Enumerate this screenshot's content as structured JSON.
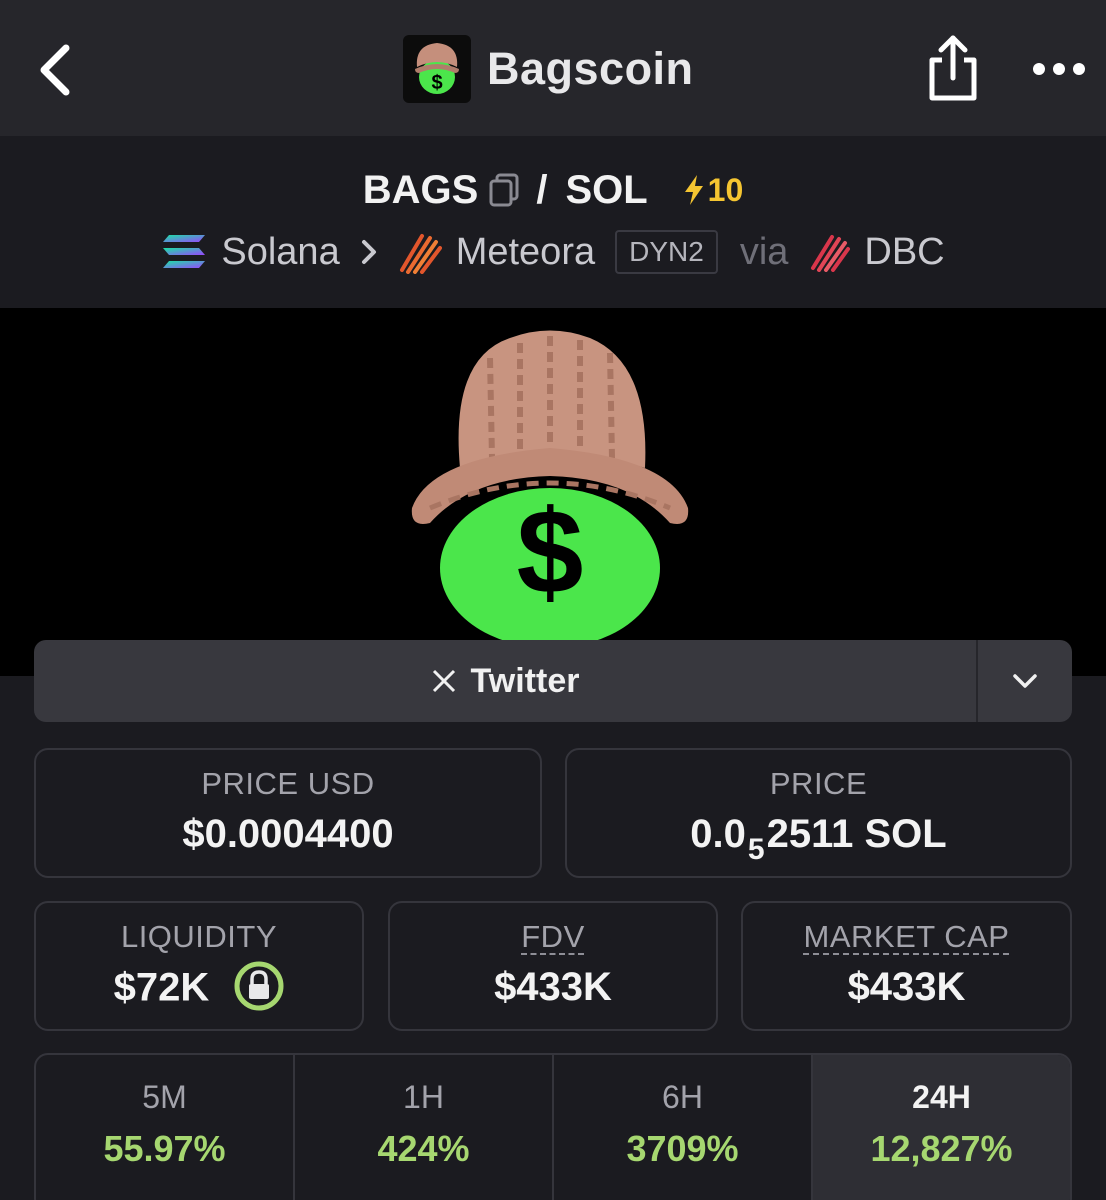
{
  "nav": {
    "title": "Bagscoin"
  },
  "pair": {
    "base": "BAGS",
    "separator": "/",
    "quote": "SOL",
    "boost_count": "10"
  },
  "chain": {
    "network": "Solana",
    "dex": "Meteora",
    "dex_badge": "DYN2",
    "via_label": "via",
    "via_dex": "DBC"
  },
  "socials": {
    "primary_label": "Twitter"
  },
  "stats": {
    "price_usd": {
      "label": "PRICE USD",
      "value": "$0.0004400"
    },
    "price_native": {
      "label": "PRICE",
      "prefix": "0.0",
      "zero_count": "5",
      "digits": "2511",
      "unit": "SOL"
    },
    "liquidity": {
      "label": "LIQUIDITY",
      "value": "$72K"
    },
    "fdv": {
      "label": "FDV",
      "value": "$433K"
    },
    "market_cap": {
      "label": "MARKET CAP",
      "value": "$433K"
    }
  },
  "timeframes": [
    {
      "label": "5M",
      "value": "55.97%"
    },
    {
      "label": "1H",
      "value": "424%"
    },
    {
      "label": "6H",
      "value": "3709%"
    },
    {
      "label": "24H",
      "value": "12,827%"
    }
  ],
  "colors": {
    "positive": "#a6d770",
    "boost": "#f5c531",
    "coin_green": "#4be64b",
    "background": "#1b1b20"
  }
}
